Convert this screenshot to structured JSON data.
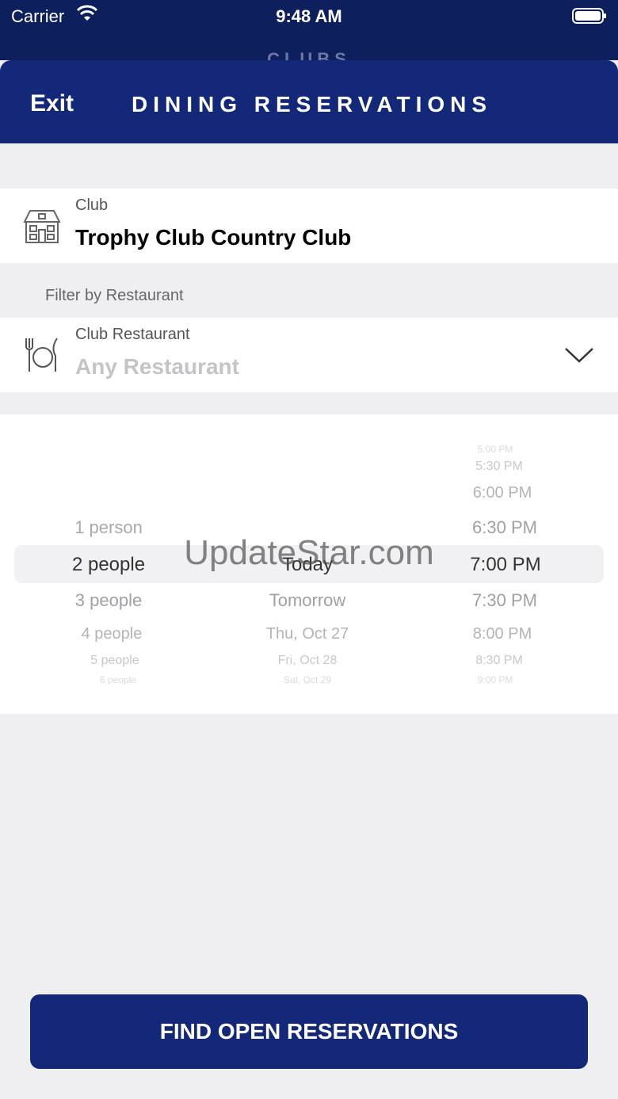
{
  "status_bar": {
    "carrier": "Carrier",
    "time": "9:48 AM"
  },
  "background_title": "CLUBS",
  "header": {
    "exit_label": "Exit",
    "title": "DINING RESERVATIONS"
  },
  "club": {
    "label": "Club",
    "value": "Trophy Club Country Club",
    "icon": "clubhouse-icon"
  },
  "filter": {
    "section_label": "Filter by Restaurant",
    "label": "Club Restaurant",
    "value": "Any Restaurant",
    "icon": "fork-knife-plate-icon"
  },
  "picker": {
    "party_sizes": [
      "1 person",
      "2 people",
      "3 people",
      "4 people",
      "5 people",
      "6 people"
    ],
    "selected_party": "2 people",
    "dates": [
      "Today",
      "Tomorrow",
      "Thu, Oct 27",
      "Fri, Oct 28",
      "Sat, Oct 29"
    ],
    "selected_date": "Today",
    "times": [
      "5:00 PM",
      "5:30 PM",
      "6:00 PM",
      "6:30 PM",
      "7:00 PM",
      "7:30 PM",
      "8:00 PM",
      "8:30 PM",
      "9:00 PM"
    ],
    "selected_time": "7:00 PM"
  },
  "watermark": "UpdateStar.com",
  "action": {
    "find_label": "FIND OPEN RESERVATIONS"
  },
  "colors": {
    "nav": "#14287a",
    "status": "#0e1f5e",
    "background": "#efeff1"
  }
}
